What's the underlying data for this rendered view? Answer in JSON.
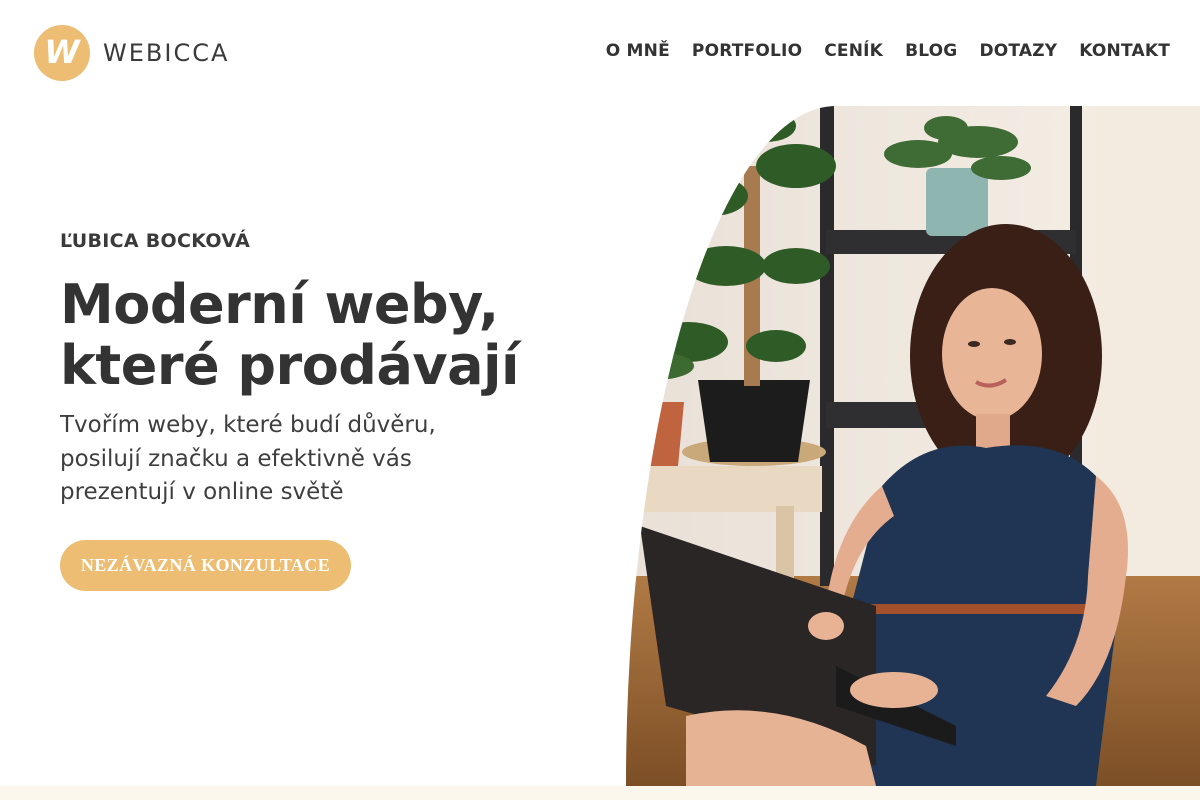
{
  "brand": {
    "logo_letter": "W",
    "name": "WEBICCA",
    "accent_color": "#ecbd72"
  },
  "nav": {
    "items": [
      "O MNĚ",
      "PORTFOLIO",
      "CENÍK",
      "BLOG",
      "DOTAZY",
      "KONTAKT"
    ]
  },
  "hero": {
    "eyebrow": "ĽUBICA BOCKOVÁ",
    "headline_line1": "Moderní weby,",
    "headline_line2": "které prodávají",
    "subtitle": "Tvořím weby, které budí důvěru, posilují značku a efektivně vás prezentují v online světě",
    "cta_label": "NEZÁVAZNÁ KONZULTACE"
  }
}
